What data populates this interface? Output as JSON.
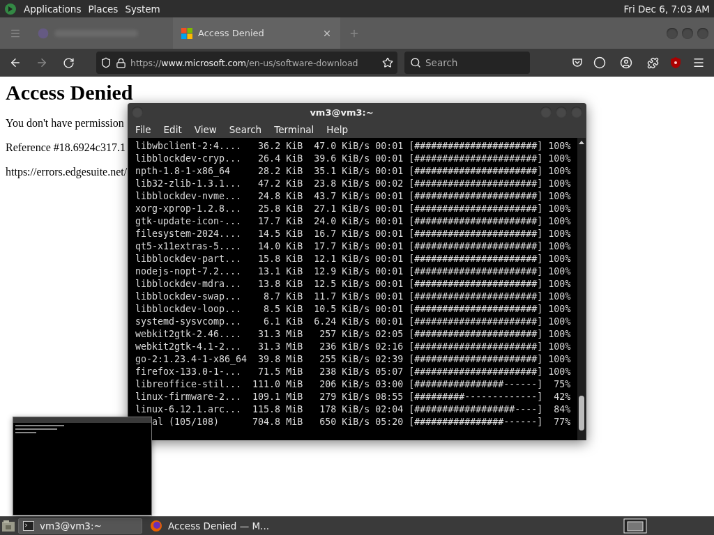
{
  "top_panel": {
    "menus": [
      "Applications",
      "Places",
      "System"
    ],
    "clock": "Fri Dec 6, 7:03 AM"
  },
  "browser": {
    "tabs": [
      {
        "kind": "blurred",
        "selected": false
      },
      {
        "kind": "page",
        "title": "Access Denied",
        "selected": true
      }
    ],
    "toolbar": {
      "back": {
        "disabled": false
      },
      "forward": {
        "disabled": true
      },
      "url": "https://**www.microsoft.com**/en-us/software-download",
      "search": {
        "placeholder": "Search"
      }
    },
    "page": {
      "heading": "Access Denied",
      "lines": [
        "You don't have permission",
        "Reference #18.6924c317.1",
        "https://errors.edgesuite.net/"
      ]
    }
  },
  "terminal": {
    "title": "vm3@vm3:~",
    "menu": [
      "File",
      "Edit",
      "View",
      "Search",
      "Terminal",
      "Help"
    ],
    "rows": [
      {
        "kind": "package",
        "name": "libwbclient-2:4....",
        "size": "36.2 KiB",
        "rate": "47.0 KiB/s",
        "time": "00:01",
        "bar": "[######################]",
        "percent": "100%"
      },
      {
        "kind": "package",
        "name": "libblockdev-cryp...",
        "size": "26.4 KiB",
        "rate": "39.6 KiB/s",
        "time": "00:01",
        "bar": "[######################]",
        "percent": "100%"
      },
      {
        "kind": "package",
        "name": "npth-1.8-1-x86_64",
        "size": "28.2 KiB",
        "rate": "35.1 KiB/s",
        "time": "00:01",
        "bar": "[######################]",
        "percent": "100%"
      },
      {
        "kind": "package",
        "name": "lib32-zlib-1.3.1...",
        "size": "47.2 KiB",
        "rate": "23.8 KiB/s",
        "time": "00:02",
        "bar": "[######################]",
        "percent": "100%"
      },
      {
        "kind": "package",
        "name": "libblockdev-nvme...",
        "size": "24.8 KiB",
        "rate": "43.7 KiB/s",
        "time": "00:01",
        "bar": "[######################]",
        "percent": "100%"
      },
      {
        "kind": "package",
        "name": "xorg-xprop-1.2.8...",
        "size": "25.8 KiB",
        "rate": "27.1 KiB/s",
        "time": "00:01",
        "bar": "[######################]",
        "percent": "100%"
      },
      {
        "kind": "package",
        "name": "gtk-update-icon-...",
        "size": "17.7 KiB",
        "rate": "24.0 KiB/s",
        "time": "00:01",
        "bar": "[######################]",
        "percent": "100%"
      },
      {
        "kind": "package",
        "name": "filesystem-2024....",
        "size": "14.5 KiB",
        "rate": "16.7 KiB/s",
        "time": "00:01",
        "bar": "[######################]",
        "percent": "100%"
      },
      {
        "kind": "package",
        "name": "qt5-x11extras-5....",
        "size": "14.0 KiB",
        "rate": "17.7 KiB/s",
        "time": "00:01",
        "bar": "[######################]",
        "percent": "100%"
      },
      {
        "kind": "package",
        "name": "libblockdev-part...",
        "size": "15.8 KiB",
        "rate": "12.1 KiB/s",
        "time": "00:01",
        "bar": "[######################]",
        "percent": "100%"
      },
      {
        "kind": "package",
        "name": "nodejs-nopt-7.2....",
        "size": "13.1 KiB",
        "rate": "12.9 KiB/s",
        "time": "00:01",
        "bar": "[######################]",
        "percent": "100%"
      },
      {
        "kind": "package",
        "name": "libblockdev-mdra...",
        "size": "13.8 KiB",
        "rate": "12.5 KiB/s",
        "time": "00:01",
        "bar": "[######################]",
        "percent": "100%"
      },
      {
        "kind": "package",
        "name": "libblockdev-swap...",
        "size": "8.7 KiB",
        "rate": "11.7 KiB/s",
        "time": "00:01",
        "bar": "[######################]",
        "percent": "100%"
      },
      {
        "kind": "package",
        "name": "libblockdev-loop...",
        "size": "8.5 KiB",
        "rate": "10.5 KiB/s",
        "time": "00:01",
        "bar": "[######################]",
        "percent": "100%"
      },
      {
        "kind": "package",
        "name": "systemd-sysvcomp...",
        "size": "6.1 KiB",
        "rate": "6.24 KiB/s",
        "time": "00:01",
        "bar": "[######################]",
        "percent": "100%"
      },
      {
        "kind": "package",
        "name": "webkit2gtk-2.46....",
        "size": "31.3 MiB",
        "rate": "257 KiB/s",
        "time": "02:05",
        "bar": "[######################]",
        "percent": "100%"
      },
      {
        "kind": "package",
        "name": "webkit2gtk-4.1-2...",
        "size": "31.3 MiB",
        "rate": "236 KiB/s",
        "time": "02:16",
        "bar": "[######################]",
        "percent": "100%"
      },
      {
        "kind": "package",
        "name": "go-2:1.23.4-1-x86_64",
        "size": "39.8 MiB",
        "rate": "255 KiB/s",
        "time": "02:39",
        "bar": "[######################]",
        "percent": "100%"
      },
      {
        "kind": "package",
        "name": "firefox-133.0-1-...",
        "size": "71.5 MiB",
        "rate": "238 KiB/s",
        "time": "05:07",
        "bar": "[######################]",
        "percent": "100%"
      },
      {
        "kind": "package",
        "name": "libreoffice-stil...",
        "size": "111.0 MiB",
        "rate": "206 KiB/s",
        "time": "03:00",
        "bar": "[################------]",
        "percent": "75%"
      },
      {
        "kind": "package",
        "name": "linux-firmware-2...",
        "size": "109.1 MiB",
        "rate": "279 KiB/s",
        "time": "08:55",
        "bar": "[#########-------------]",
        "percent": "42%"
      },
      {
        "kind": "package",
        "name": "linux-6.12.1.arc...",
        "size": "115.8 MiB",
        "rate": "178 KiB/s",
        "time": "02:04",
        "bar": "[##################----]",
        "percent": "84%"
      },
      {
        "kind": "total",
        "name": "al (105/108)",
        "size": "704.8 MiB",
        "rate": "650 KiB/s",
        "time": "05:20",
        "bar": "[################------]",
        "percent": "77%"
      }
    ]
  },
  "taskbar": {
    "tasks": [
      {
        "kind": "terminal",
        "label": "vm3@vm3:~",
        "selected": true
      },
      {
        "kind": "browser",
        "label": "Access Denied — M...",
        "selected": false
      }
    ]
  }
}
